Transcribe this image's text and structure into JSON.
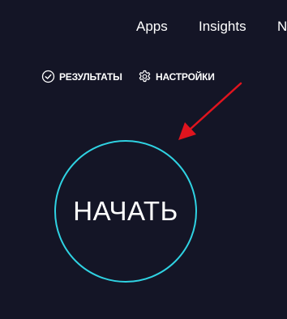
{
  "top_nav": {
    "items": [
      {
        "label": "Apps"
      },
      {
        "label": "Insights"
      },
      {
        "label": "N"
      }
    ]
  },
  "sub_nav": {
    "results_label": "РЕЗУЛЬТАТЫ",
    "results_icon": "check-circle-icon",
    "settings_label": "НАСТРОЙКИ",
    "settings_icon": "gear-icon"
  },
  "go_button": {
    "label": "НАЧАТЬ"
  },
  "colors": {
    "background": "#141526",
    "ring": "#2fd2e2",
    "text": "#ffffff",
    "annotation_arrow": "#e0141e"
  }
}
